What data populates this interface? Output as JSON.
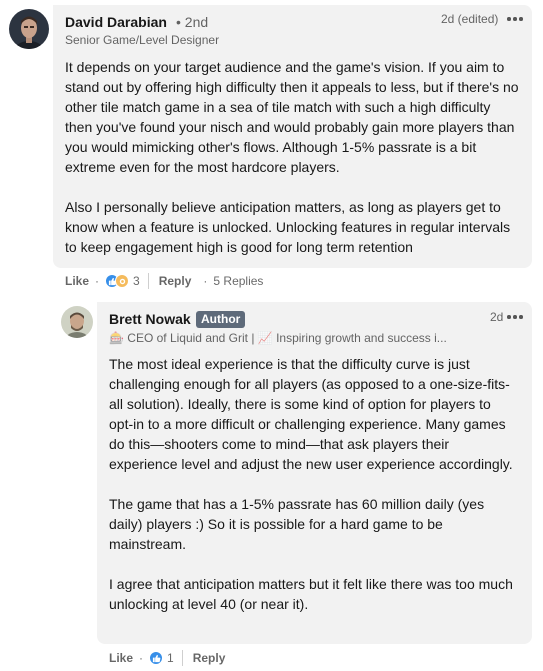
{
  "comments": [
    {
      "author": "David Darabian",
      "degree": "• 2nd",
      "headline": "Senior Game/Level Designer",
      "time": "2d (edited)",
      "paragraphs": [
        "It depends on your target audience and the game's vision. If you aim to stand out by offering high difficulty then it appeals to less, but if there's no other tile match game in a sea of tile match with such a high difficulty then you've found your nisch and would probably gain more players than you would mimicking other's flows. Although 1-5% passrate is a bit extreme even for the most hardcore players.",
        "Also I personally believe anticipation matters, as long as players get to know when a feature is unlocked. Unlocking features in regular intervals to keep engagement high is good for long term retention"
      ],
      "like_label": "Like",
      "reaction_count": "3",
      "reply_label": "Reply",
      "replies_label": "5 Replies"
    }
  ],
  "reply": {
    "author": "Brett Nowak",
    "badge": "Author",
    "headline": "🎰 CEO of Liquid and Grit | 📈 Inspiring growth and success i...",
    "time": "2d",
    "paragraphs": [
      "The most ideal experience is that the difficulty curve is just challenging enough for all players (as opposed to a one-size-fits-all solution). Ideally, there is some kind of option for players to opt-in to a more difficult or challenging experience. Many games do this—shooters come to mind—that ask players their experience level and adjust the new user experience accordingly.",
      "The game that has a 1-5% passrate has 60 million daily (yes daily) players :) So it is possible for a hard game to be mainstream.",
      "I agree that anticipation matters but it felt like there was too much unlocking at level 40 (or near it)."
    ],
    "like_label": "Like",
    "reaction_count": "1",
    "reply_label": "Reply"
  },
  "icons": {
    "like": "like-reaction-icon",
    "celebrate": "celebrate-reaction-icon",
    "more": "more-options-icon"
  },
  "colors": {
    "bubble": "#f2f2f2",
    "like_blue": "#378fe9",
    "celebrate_gold": "#f5bb5c",
    "author_badge": "#5e6a7a"
  }
}
